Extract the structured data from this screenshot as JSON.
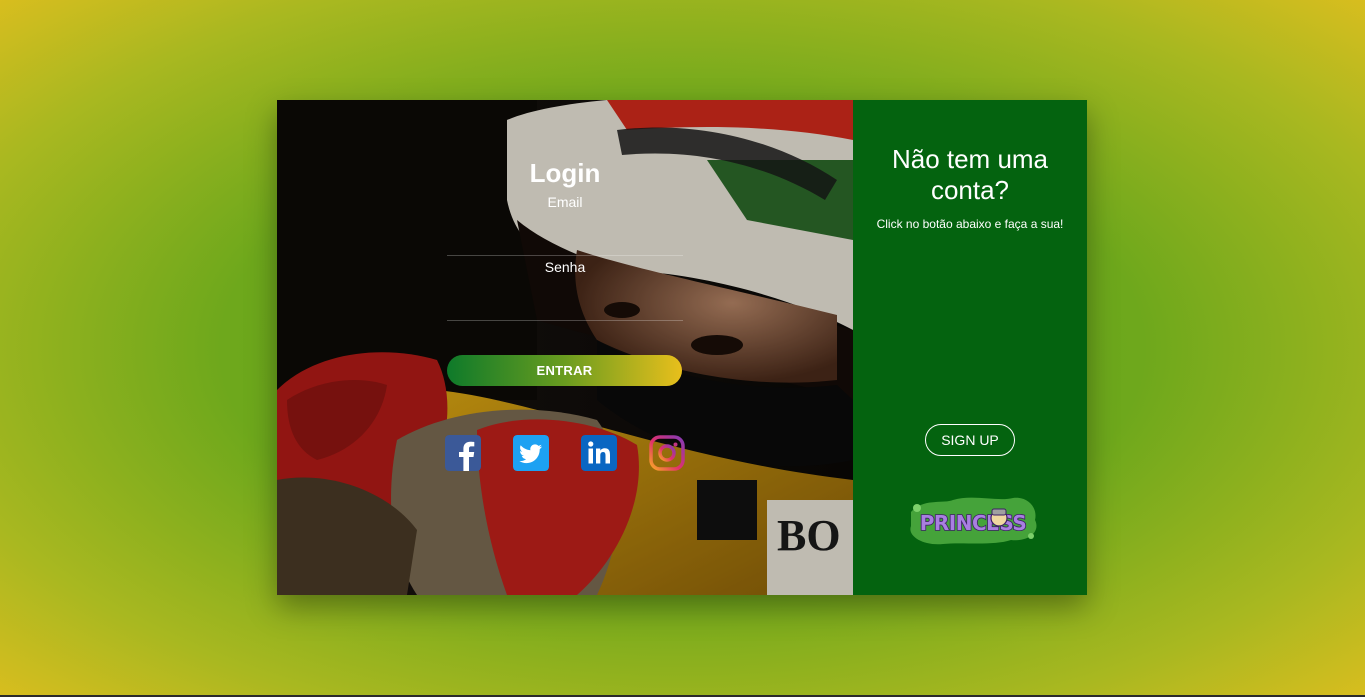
{
  "login": {
    "title": "Login",
    "email_label": "Email",
    "password_label": "Senha",
    "submit_label": "ENTRAR"
  },
  "social": [
    {
      "name": "facebook",
      "icon": "facebook-icon",
      "color": "#3b5998"
    },
    {
      "name": "twitter",
      "icon": "twitter-icon",
      "color": "#1da1f2"
    },
    {
      "name": "linkedin",
      "icon": "linkedin-icon",
      "color": "#0a66c2"
    },
    {
      "name": "instagram",
      "icon": "instagram-icon",
      "color": "#c13584"
    }
  ],
  "signup": {
    "title": "Não tem uma conta?",
    "text": "Click no botão abaixo e faça a sua!",
    "button_label": "SIGN UP",
    "logo_text": "PRINCESS"
  },
  "colors": {
    "panel_green": "#04630f",
    "button_gradient_start": "#0e7a2a",
    "button_gradient_end": "#e8bf1c",
    "background_center": "#5ea11c",
    "background_edge": "#e6bf1e"
  }
}
